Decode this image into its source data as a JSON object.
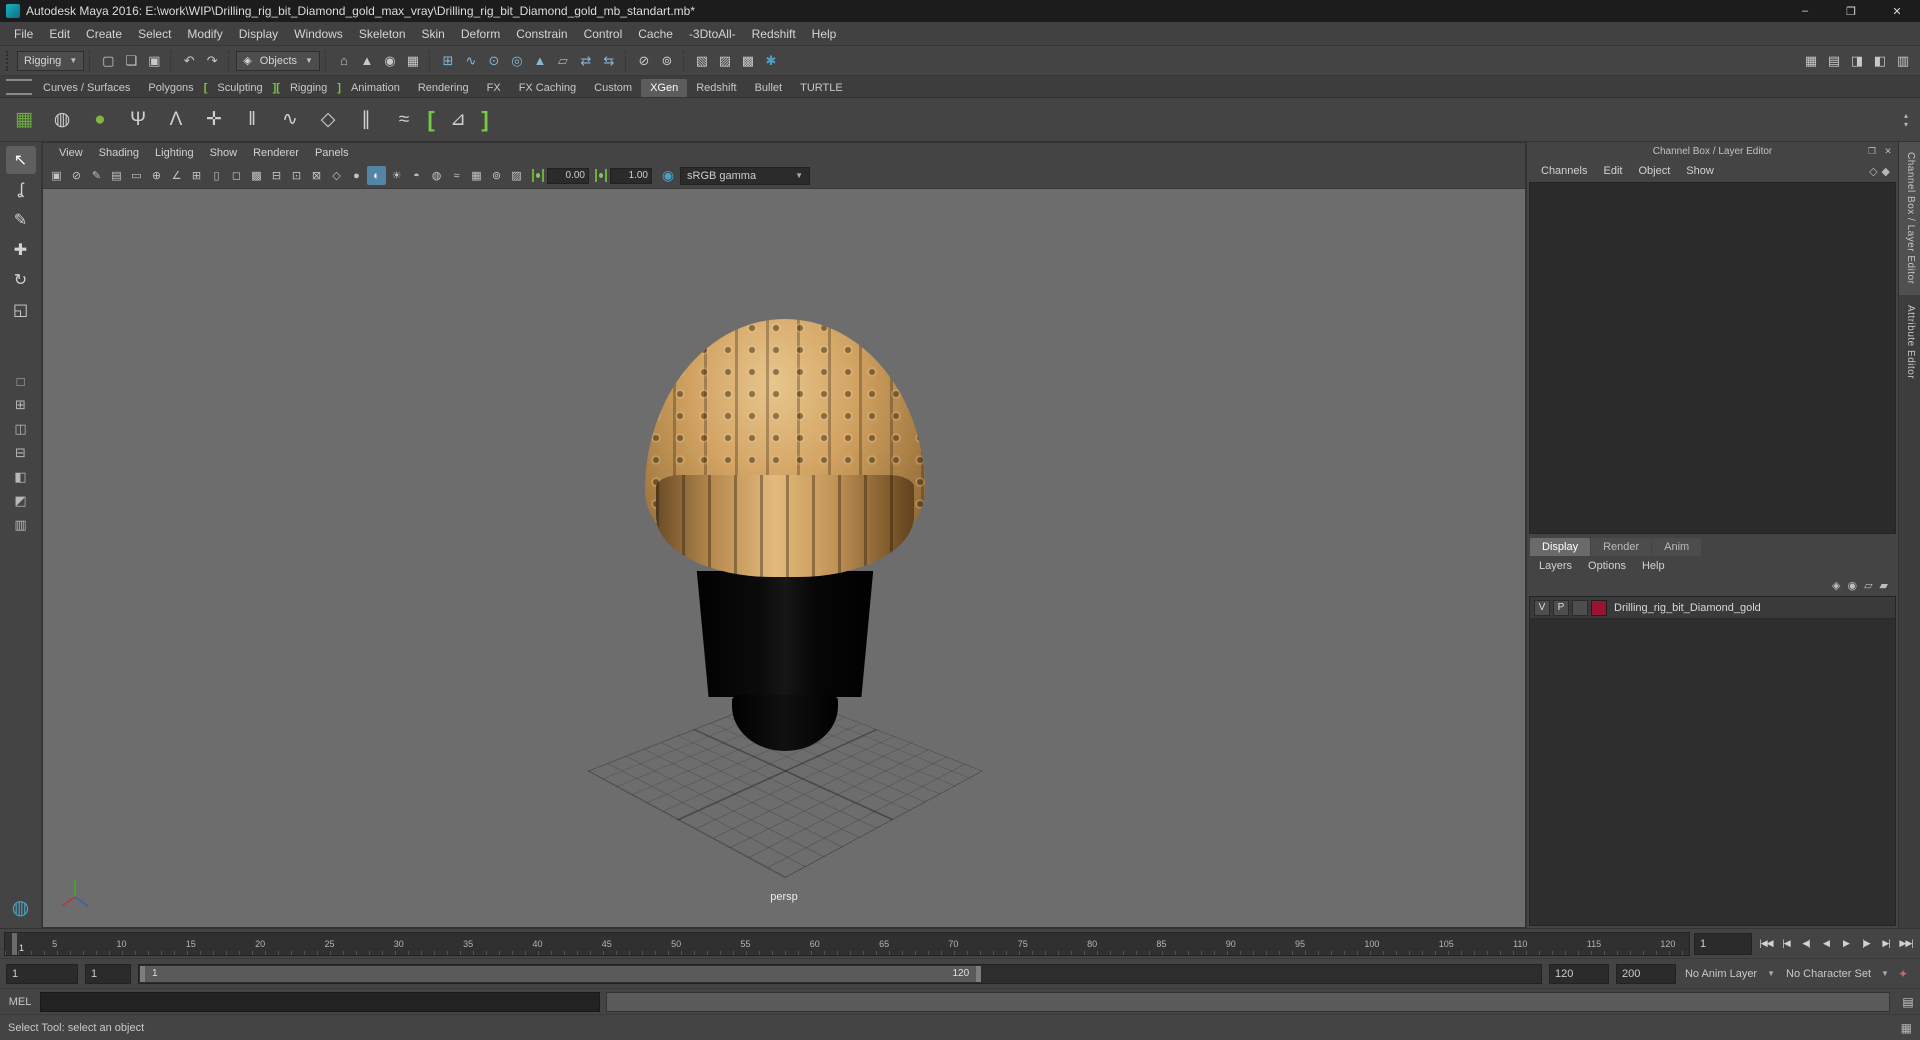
{
  "titlebar": {
    "title": "Autodesk Maya 2016: E:\\work\\WIP\\Drilling_rig_bit_Diamond_gold_max_vray\\Drilling_rig_bit_Diamond_gold_mb_standart.mb*",
    "minimize": "–",
    "maximize": "❐",
    "close": "✕"
  },
  "menubar": {
    "items": [
      "File",
      "Edit",
      "Create",
      "Select",
      "Modify",
      "Display",
      "Windows",
      "Skeleton",
      "Skin",
      "Deform",
      "Constrain",
      "Control",
      "Cache",
      "-3DtoAll-",
      "Redshift",
      "Help"
    ]
  },
  "statusline": {
    "mode": "Rigging",
    "file_icons": [
      {
        "name": "new-scene-icon",
        "glyph": "▢"
      },
      {
        "name": "open-scene-icon",
        "glyph": "❏"
      },
      {
        "name": "save-scene-icon",
        "glyph": "▣"
      }
    ],
    "history_icons": [
      {
        "name": "undo-icon",
        "glyph": "↶"
      },
      {
        "name": "redo-icon",
        "glyph": "↷"
      }
    ],
    "selection_combo": {
      "icon": "◈",
      "label": "Objects"
    },
    "mask_icons": [
      {
        "name": "select-hierarchy-mode-icon",
        "glyph": "⌂"
      },
      {
        "name": "select-object-mode-icon",
        "glyph": "▲"
      },
      {
        "name": "select-component-mode-icon",
        "glyph": "◉"
      },
      {
        "name": "highlight-selection-mode-icon",
        "glyph": "▦"
      }
    ],
    "snap_icons": [
      {
        "name": "snap-to-grids-icon",
        "glyph": "⊞"
      },
      {
        "name": "snap-to-curves-icon",
        "glyph": "∿"
      },
      {
        "name": "snap-to-points-icon",
        "glyph": "⊙"
      },
      {
        "name": "snap-to-projected-center-icon",
        "glyph": "◎"
      },
      {
        "name": "make-live-icon",
        "glyph": "▲"
      },
      {
        "name": "snap-to-view-planes-icon",
        "glyph": "▱"
      },
      {
        "name": "input-connections-icon",
        "glyph": "⇄"
      },
      {
        "name": "output-connections-icon",
        "glyph": "⇆"
      }
    ],
    "lock_icons": [
      {
        "name": "lock-selection-icon",
        "glyph": "⊘"
      },
      {
        "name": "highlight-affected-icon",
        "glyph": "⊚"
      }
    ],
    "render_icons": [
      {
        "name": "render-view-icon",
        "glyph": "▧"
      },
      {
        "name": "ipr-render-icon",
        "glyph": "▨"
      },
      {
        "name": "render-current-frame-icon",
        "glyph": "▩"
      },
      {
        "name": "render-settings-icon",
        "glyph": "✱",
        "color": "#4aa3c7"
      }
    ],
    "right_icons": [
      {
        "name": "modeling-toolkit-toggle-icon",
        "glyph": "▦"
      },
      {
        "name": "outliner-toggle-icon",
        "glyph": "▤"
      },
      {
        "name": "attribute-editor-toggle-icon",
        "glyph": "◨"
      },
      {
        "name": "tool-settings-toggle-icon",
        "glyph": "◧"
      },
      {
        "name": "channel-box-toggle-icon",
        "glyph": "▥"
      }
    ]
  },
  "shelf": {
    "tabs": [
      {
        "label": "Curves / Surfaces",
        "name": "shelf-tab-curves-surfaces"
      },
      {
        "label": "Polygons",
        "name": "shelf-tab-polygons"
      },
      {
        "label": "[",
        "name": "green-bracket-icon",
        "cls": "bracket",
        "inter": false
      },
      {
        "label": "Sculpting",
        "name": "shelf-tab-sculpting"
      },
      {
        "label": "][",
        "name": "green-bracket-icon",
        "cls": "bracket",
        "inter": false
      },
      {
        "label": "Rigging",
        "name": "shelf-tab-rigging"
      },
      {
        "label": "]",
        "name": "green-bracket-icon",
        "cls": "bracket",
        "inter": false
      },
      {
        "label": "Animation",
        "name": "shelf-tab-animation"
      },
      {
        "label": "Rendering",
        "name": "shelf-tab-rendering"
      },
      {
        "label": "FX",
        "name": "shelf-tab-fx"
      },
      {
        "label": "FX Caching",
        "name": "shelf-tab-fx-caching"
      },
      {
        "label": "Custom",
        "name": "shelf-tab-custom"
      },
      {
        "label": "XGen",
        "name": "shelf-tab-xgen",
        "cls": "active"
      },
      {
        "label": "Redshift",
        "name": "shelf-tab-redshift"
      },
      {
        "label": "Bullet",
        "name": "shelf-tab-bullet"
      },
      {
        "label": "TURTLE",
        "name": "shelf-tab-turtle"
      }
    ],
    "icons": [
      {
        "name": "xgen-editor-icon",
        "glyph": "▦",
        "color": "#6fae3e"
      },
      {
        "name": "xgen-create-description-icon",
        "glyph": "◍",
        "color": "#cfcfcf"
      },
      {
        "name": "xgen-preview-sphere-icon",
        "glyph": "●",
        "color": "#7fb542"
      },
      {
        "name": "xgen-add-curves-icon",
        "glyph": "Ψ",
        "color": "#cfcfcf"
      },
      {
        "name": "xgen-attach-description-icon",
        "glyph": "Λ",
        "color": "#cfcfcf"
      },
      {
        "name": "xgen-place-guides-icon",
        "glyph": "✛",
        "color": "#cfcfcf"
      },
      {
        "name": "xgen-comb-guides-icon",
        "glyph": "ǁ",
        "color": "#cfcfcf"
      },
      {
        "name": "xgen-sculpt-guides-icon",
        "glyph": "∿",
        "color": "#cfcfcf"
      },
      {
        "name": "xgen-modifier-icon",
        "glyph": "◇",
        "color": "#cfcfcf"
      },
      {
        "name": "xgen-clump-modifier-icon",
        "glyph": "∥",
        "color": "#cfcfcf"
      },
      {
        "name": "xgen-noise-modifier-icon",
        "glyph": "≈",
        "color": "#cfcfcf"
      },
      {
        "name": "green-bracket-icon",
        "glyph": "[",
        "color": "#77c941",
        "cls": "bracket",
        "inter": false
      },
      {
        "name": "xgen-export-icon",
        "glyph": "⊿",
        "color": "#cfcfcf"
      },
      {
        "name": "green-bracket-icon",
        "glyph": "]",
        "color": "#77c941",
        "cls": "bracket",
        "inter": false
      }
    ],
    "scroll_up": "▴",
    "scroll_down": "▾"
  },
  "toolbox": {
    "tools": [
      {
        "name": "select-tool-icon",
        "glyph": "↖",
        "cls": "active"
      },
      {
        "name": "lasso-select-tool-icon",
        "glyph": "ʆ"
      },
      {
        "name": "paint-selection-tool-icon",
        "glyph": "✎"
      },
      {
        "name": "move-tool-icon",
        "glyph": "✚"
      },
      {
        "name": "rotate-tool-icon",
        "glyph": "↻"
      },
      {
        "name": "scale-tool-icon",
        "glyph": "◱"
      }
    ],
    "layouts": [
      {
        "name": "layout-single-pane-icon",
        "glyph": "□"
      },
      {
        "name": "layout-four-pane-icon",
        "glyph": "⊞"
      },
      {
        "name": "layout-two-pane-side-icon",
        "glyph": "◫"
      },
      {
        "name": "layout-two-pane-stacked-icon",
        "glyph": "⊟"
      },
      {
        "name": "layout-three-pane-left-icon",
        "glyph": "◧"
      },
      {
        "name": "layout-three-pane-top-icon",
        "glyph": "◩"
      },
      {
        "name": "layout-outliner-persp-icon",
        "glyph": "▥"
      }
    ],
    "bottom_icon": {
      "glyph": "◍"
    }
  },
  "panel": {
    "menus": [
      "View",
      "Shading",
      "Lighting",
      "Show",
      "Renderer",
      "Panels"
    ],
    "icons": [
      {
        "name": "select-camera-icon",
        "glyph": "▣"
      },
      {
        "name": "lock-camera-icon",
        "glyph": "⊘"
      },
      {
        "name": "camera-attributes-icon",
        "glyph": "✎"
      },
      {
        "name": "bookmark-view-icon",
        "glyph": "▤"
      },
      {
        "name": "image-plane-icon",
        "glyph": "▭"
      },
      {
        "name": "two-d-pan-zoom-icon",
        "glyph": "⊕"
      },
      {
        "name": "grease-pencil-icon",
        "glyph": "∠"
      },
      {
        "name": "grid-toggle-icon",
        "glyph": "⊞"
      },
      {
        "name": "film-gate-icon",
        "glyph": "▯"
      },
      {
        "name": "resolution-gate-icon",
        "glyph": "◻"
      },
      {
        "name": "gate-mask-icon",
        "glyph": "▩"
      },
      {
        "name": "field-chart-icon",
        "glyph": "⊟"
      },
      {
        "name": "safe-action-icon",
        "glyph": "⊡"
      },
      {
        "name": "safe-title-icon",
        "glyph": "⊠"
      },
      {
        "name": "wireframe-icon",
        "glyph": "◇"
      },
      {
        "name": "smooth-shade-all-icon",
        "glyph": "●"
      },
      {
        "name": "textured-icon",
        "glyph": "◐",
        "cls": "active"
      },
      {
        "name": "lighting-icon",
        "glyph": "☀"
      },
      {
        "name": "shadows-icon",
        "glyph": "◓"
      },
      {
        "name": "occlusion-icon",
        "glyph": "◍"
      },
      {
        "name": "motion-blur-icon",
        "glyph": "≈"
      },
      {
        "name": "multisample-aa-icon",
        "glyph": "▦"
      },
      {
        "name": "isolate-select-icon",
        "glyph": "⊚"
      },
      {
        "name": "xray-icon",
        "glyph": "▨"
      }
    ],
    "exposure": "0.00",
    "gamma": "1.00",
    "view_transform": "sRGB gamma",
    "camera": "persp"
  },
  "channelbox": {
    "title": "Channel Box / Layer Editor",
    "header_icons": [
      {
        "name": "dock-panel-icon",
        "glyph": "❐"
      },
      {
        "name": "close-panel-icon",
        "glyph": "✕"
      }
    ],
    "menus": [
      "Channels",
      "Edit",
      "Object",
      "Show"
    ],
    "menu_icons": [
      {
        "name": "channel-slider-mode-icon",
        "glyph": "◇"
      },
      {
        "name": "channel-manip-mode-icon",
        "glyph": "◆"
      }
    ],
    "tabs": [
      {
        "label": "Display",
        "name": "layer-tab-display",
        "cls": "active"
      },
      {
        "label": "Render",
        "name": "layer-tab-render"
      },
      {
        "label": "Anim",
        "name": "layer-tab-anim"
      }
    ],
    "layer_menus": [
      "Layers",
      "Options",
      "Help"
    ],
    "layer_toolbar_icons": [
      {
        "name": "sync-layers-icon",
        "glyph": "◈"
      },
      {
        "name": "layers-options-icon",
        "glyph": "◉"
      },
      {
        "name": "create-empty-layer-icon",
        "glyph": "▱"
      },
      {
        "name": "create-layer-from-selected-icon",
        "glyph": "▰"
      }
    ],
    "layer": {
      "visibility": "V",
      "playback": "P",
      "name": "Drilling_rig_bit_Diamond_gold",
      "swatch": "#9b1236"
    },
    "side_tabs": [
      {
        "label": "Channel Box / Layer Editor",
        "name": "side-tab-channel-box",
        "cls": "active"
      },
      {
        "label": "Attribute Editor",
        "name": "side-tab-attribute-editor"
      }
    ]
  },
  "timeline": {
    "ticks": [
      "5",
      "10",
      "15",
      "20",
      "25",
      "30",
      "35",
      "40",
      "45",
      "50",
      "55",
      "60",
      "65",
      "70",
      "75",
      "80",
      "85",
      "90",
      "95",
      "100",
      "105",
      "110",
      "115",
      "120"
    ],
    "current": "1",
    "current_field": "1",
    "playback": [
      {
        "name": "go-to-start-button",
        "label": "|◀◀"
      },
      {
        "name": "step-back-frame-button",
        "label": "|◀"
      },
      {
        "name": "step-back-key-button",
        "label": "◀|"
      },
      {
        "name": "play-backwards-button",
        "label": "◀"
      },
      {
        "name": "play-forwards-button",
        "label": "▶"
      },
      {
        "name": "step-forward-key-button",
        "label": "|▶"
      },
      {
        "name": "step-forward-frame-button",
        "label": "▶|"
      },
      {
        "name": "go-to-end-button",
        "label": "▶▶|"
      }
    ]
  },
  "range": {
    "start_field": "1",
    "playback_start_field": "1",
    "bar_start": "1",
    "bar_end": "120",
    "playback_end_field": "120",
    "end_field": "200",
    "anim_layer": "No Anim Layer",
    "character_set": "No Character Set",
    "icons": [
      {
        "name": "auto-keyframe-icon",
        "glyph": "✦",
        "color": "#c06a6a"
      },
      {
        "name": "animation-preferences-icon",
        "gl​yph": "✱"
      }
    ]
  },
  "command": {
    "label": "MEL"
  },
  "help": {
    "text": "Select Tool: select an object",
    "icon_glyph": "▦"
  }
}
